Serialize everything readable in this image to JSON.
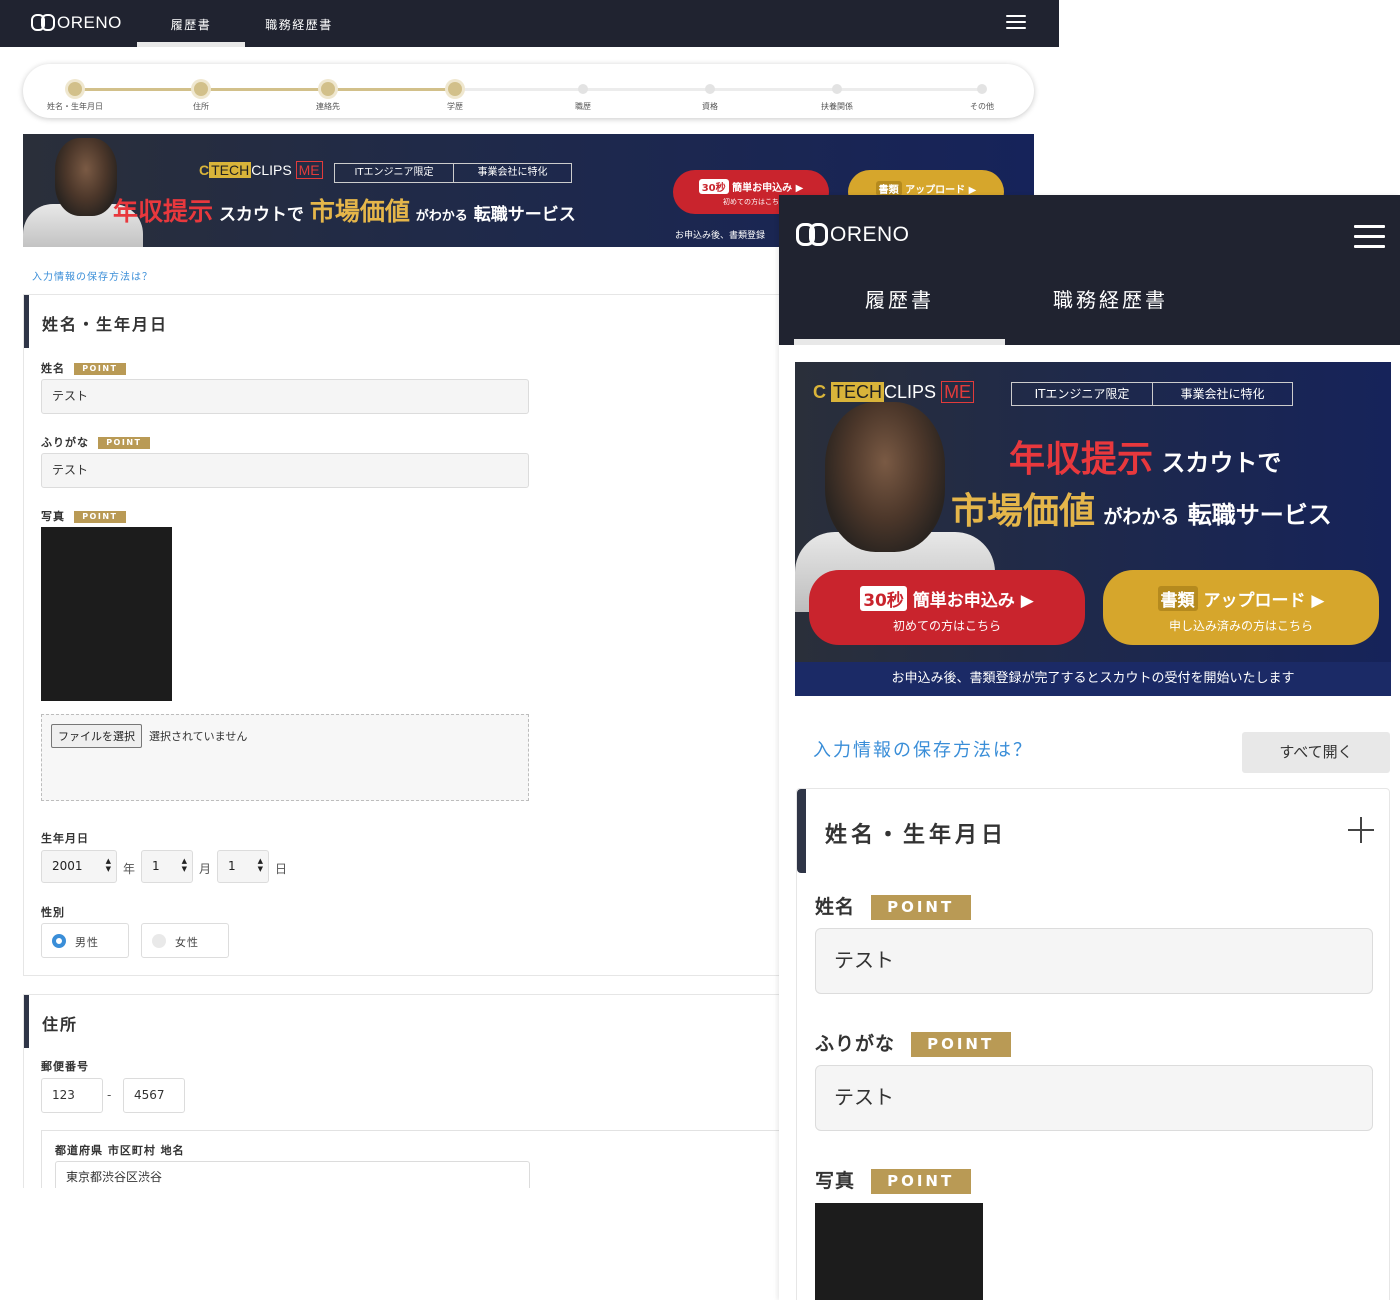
{
  "desktop": {
    "header": {
      "logo": "ORENO",
      "tabs": [
        "履歴書",
        "職務経歴書"
      ],
      "active_tab": "履歴書"
    },
    "steps": {
      "items": [
        "姓名・生年月日",
        "住所",
        "連絡先",
        "学歴",
        "職歴",
        "資格",
        "扶養関係",
        "その他"
      ],
      "completed": 4
    },
    "banner": {
      "brand_c": "C",
      "brand_tech": "TECH",
      "brand_clips": "CLIPS",
      "brand_me": "ME",
      "tag1": "ITエンジニア限定",
      "tag2": "事業会社に特化",
      "head_red": "年収提示",
      "head_w1": "スカウトで",
      "head_gold": "市場価値",
      "head_w2": "がわかる",
      "head_w3": "転職サービス",
      "btn1_badge": "30秒",
      "btn1_label": "簡単お申込み",
      "btn1_sub": "初めての方はこち",
      "btn2_badge": "書類",
      "btn2_label": "アップロード",
      "footer": "お申込み後、書類登録"
    },
    "save_link": "入力情報の保存方法は？",
    "section1": {
      "title": "姓名・生年月日",
      "point": "POINT",
      "name_label": "姓名",
      "name_value": "テスト",
      "kana_label": "ふりがな",
      "kana_value": "テスト",
      "photo_label": "写真",
      "file_button": "ファイルを選択",
      "file_status": "選択されていません",
      "birth_label": "生年月日",
      "year": "2001",
      "year_unit": "年",
      "month": "1",
      "month_unit": "月",
      "day": "1",
      "day_unit": "日",
      "gender_label": "性別",
      "male": "男性",
      "female": "女性",
      "selected_gender": "男性"
    },
    "section2": {
      "title": "住所",
      "zip_label": "郵便番号",
      "zip1": "123",
      "zip_sep": "-",
      "zip2": "4567",
      "pref_label": "都道府県 市区町村 地名",
      "pref_value": "東京都渋谷区渋谷"
    }
  },
  "mobile": {
    "header": {
      "logo": "ORENO",
      "tabs": [
        "履歴書",
        "職務経歴書"
      ],
      "active_tab": "履歴書"
    },
    "banner": {
      "brand_c": "C",
      "brand_tech": "TECH",
      "brand_clips": "CLIPS",
      "brand_me": "ME",
      "tag1": "ITエンジニア限定",
      "tag2": "事業会社に特化",
      "head_red": "年収提示",
      "head_w1": "スカウトで",
      "head_gold": "市場価値",
      "head_w2": "がわかる",
      "head_w3": "転職サービス",
      "btn1_badge": "30秒",
      "btn1_label": "簡単お申込み",
      "btn1_sub": "初めての方はこちら",
      "btn2_badge": "書類",
      "btn2_label": "アップロード",
      "btn2_sub": "申し込み済みの方はこちら",
      "footer": "お申込み後、書類登録が完了するとスカウトの受付を開始いたします"
    },
    "save_link": "入力情報の保存方法は？",
    "open_all": "すべて開く",
    "section1": {
      "title": "姓名・生年月日",
      "point": "POINT",
      "name_label": "姓名",
      "name_value": "テスト",
      "kana_label": "ふりがな",
      "kana_value": "テスト",
      "photo_label": "写真"
    }
  },
  "colors": {
    "header_bg": "#202330",
    "accent_gold": "#b99a55",
    "link_blue": "#3a8ed8",
    "step_done": "#d2c08a",
    "section_bar": "#2f3547"
  }
}
